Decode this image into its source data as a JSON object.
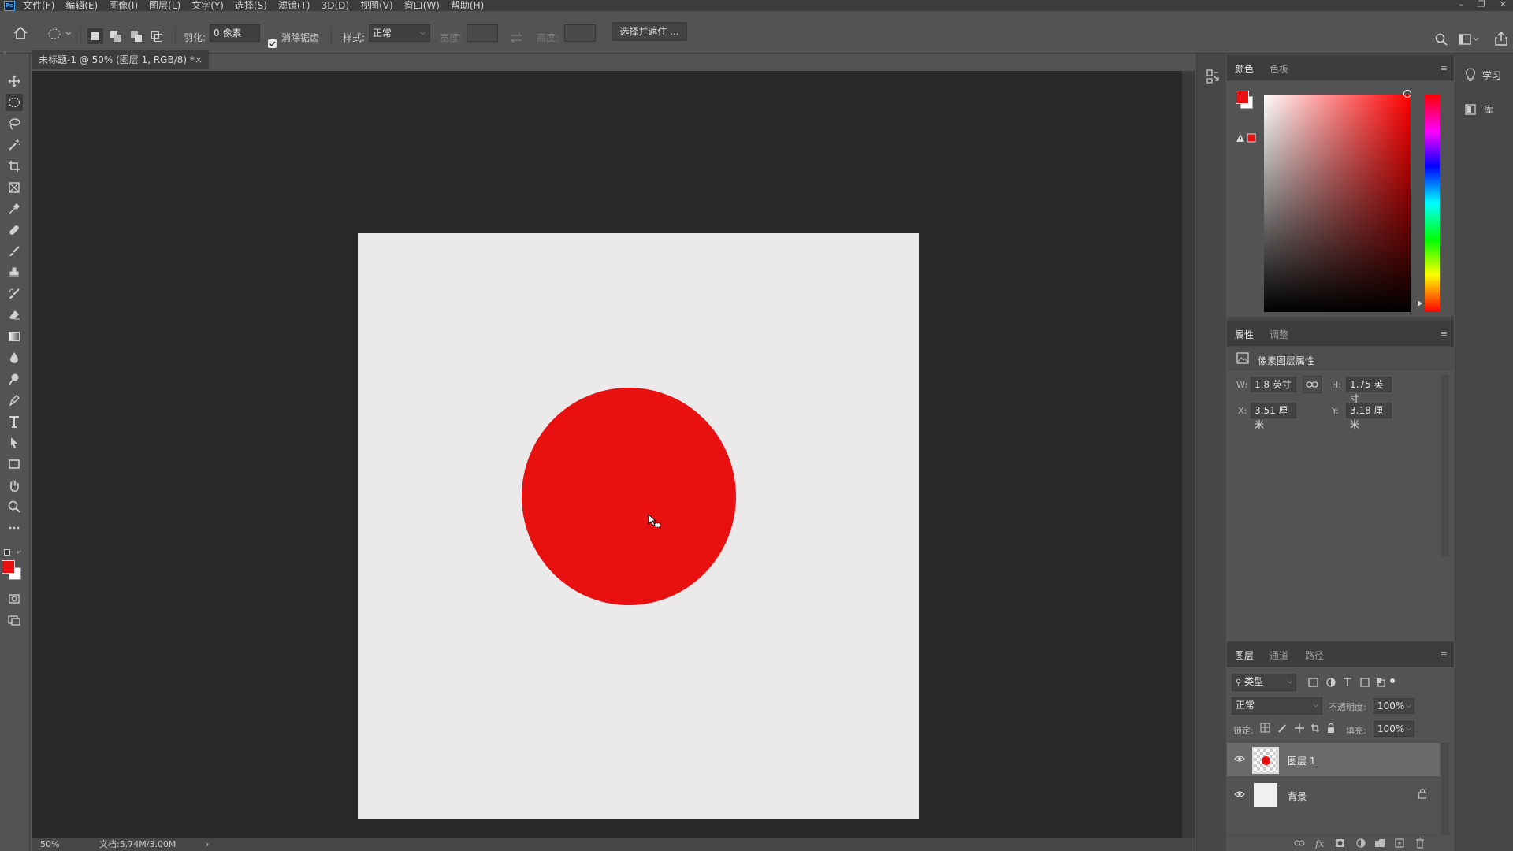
{
  "app": {
    "logo": "Ps"
  },
  "menu": [
    "文件(F)",
    "编辑(E)",
    "图像(I)",
    "图层(L)",
    "文字(Y)",
    "选择(S)",
    "滤镜(T)",
    "3D(D)",
    "视图(V)",
    "窗口(W)",
    "帮助(H)"
  ],
  "options": {
    "feather_label": "羽化:",
    "feather_value": "0 像素",
    "antialias_label": "消除锯齿",
    "style_label": "样式:",
    "style_value": "正常",
    "width_label": "宽度:",
    "height_label": "高度:",
    "select_mask": "选择并遮住 ..."
  },
  "document": {
    "tab_title": "未标题-1 @ 50% (图层 1, RGB/8) *",
    "close": "×",
    "shape_color": "#e81010",
    "canvas_color": "#ece9eb"
  },
  "status": {
    "zoom": "50%",
    "doc": "文档:5.74M/3.00M",
    "arrow": "›"
  },
  "color_panel": {
    "tabs": [
      "颜色",
      "色板"
    ],
    "fg": "#e81010",
    "bg": "#ffffff"
  },
  "properties_panel": {
    "tabs": [
      "属性",
      "调整"
    ],
    "section": "像素图层属性",
    "w_label": "W:",
    "w_value": "1.8 英寸",
    "h_label": "H:",
    "h_value": "1.75 英寸",
    "x_label": "X:",
    "x_value": "3.51 厘米",
    "y_label": "Y:",
    "y_value": "3.18 厘米"
  },
  "layers_panel": {
    "tabs": [
      "图层",
      "通道",
      "路径"
    ],
    "filter": "类型",
    "blend": "正常",
    "opacity_label": "不透明度:",
    "opacity_value": "100%",
    "lock_label": "锁定:",
    "fill_label": "填充:",
    "fill_value": "100%",
    "layers": [
      {
        "name": "图层 1",
        "selected": true
      },
      {
        "name": "背景",
        "selected": false,
        "locked": true
      }
    ]
  },
  "right_strip": {
    "learn": "学习",
    "library": "库"
  }
}
